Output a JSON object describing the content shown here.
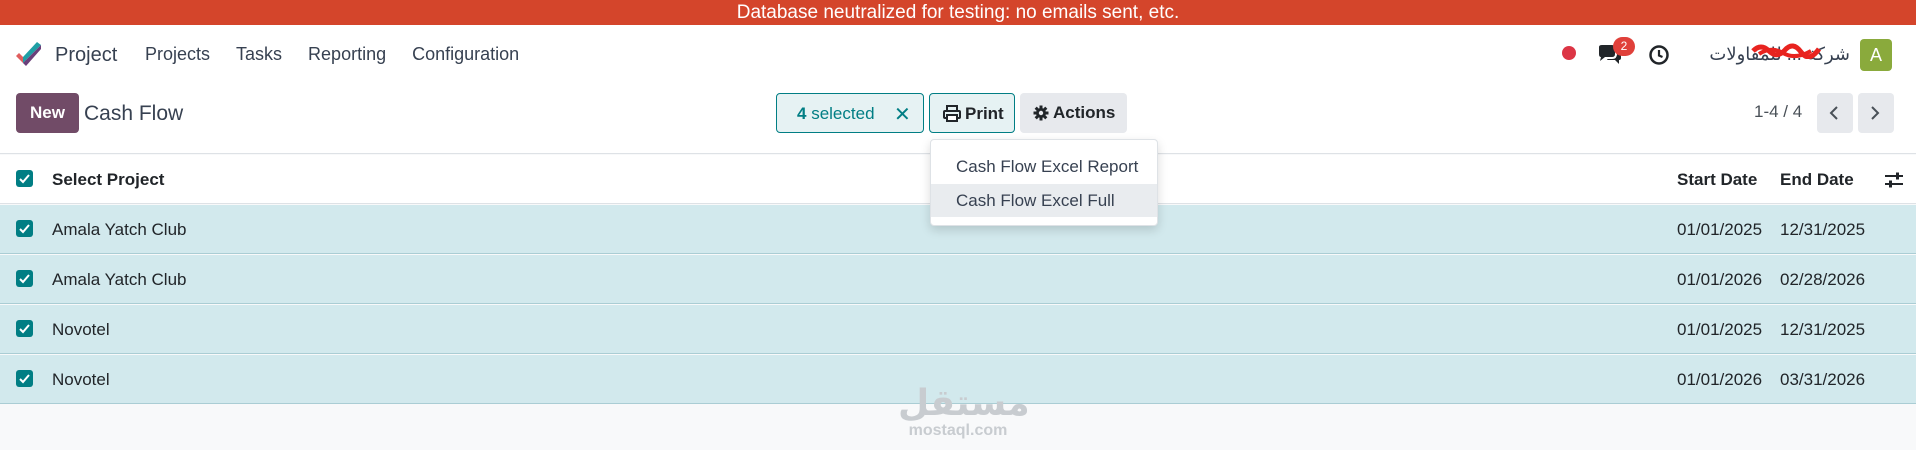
{
  "banner": {
    "text": "Database neutralized for testing: no emails sent, etc."
  },
  "navbar": {
    "app_name": "Project",
    "menu": [
      "Projects",
      "Tasks",
      "Reporting",
      "Configuration"
    ],
    "messages_badge": "2",
    "company_name": "شركة ... للمقاولات",
    "avatar_letter": "A",
    "colors": {
      "status_dot": "#dc3545",
      "badge": "#e0403a",
      "avatar": "#8aaa3c"
    }
  },
  "control": {
    "new_label": "New",
    "page_title": "Cash Flow",
    "selected_count": "4",
    "selected_label": "selected",
    "clear_icon": "close-icon",
    "print_label": "Print",
    "actions_label": "Actions",
    "pager_text": "1-4 / 4"
  },
  "print_menu": {
    "items": [
      "Cash Flow Excel Report",
      "Cash Flow Excel Full"
    ],
    "hovered_index": 1
  },
  "table": {
    "headers": {
      "select": "Select Project",
      "start": "Start Date",
      "end": "End Date"
    },
    "rows": [
      {
        "project": "Amala Yatch Club",
        "start": "01/01/2025",
        "end": "12/31/2025",
        "checked": true
      },
      {
        "project": "Amala Yatch Club",
        "start": "01/01/2026",
        "end": "02/28/2026",
        "checked": true
      },
      {
        "project": "Novotel",
        "start": "01/01/2025",
        "end": "12/31/2025",
        "checked": true
      },
      {
        "project": "Novotel",
        "start": "01/01/2026",
        "end": "03/31/2026",
        "checked": true
      }
    ]
  },
  "watermark": {
    "arabic": "مستقل",
    "latin": "mostaql.com"
  },
  "theme": {
    "primary": "#714b67",
    "teal": "#017e84",
    "selected_row": "#d2e9ed"
  }
}
